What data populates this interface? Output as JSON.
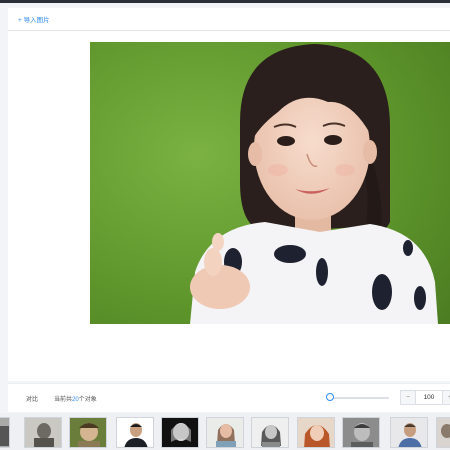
{
  "header": {
    "import_label": "+ 导入图片"
  },
  "toolbar": {
    "compare_label": "对比",
    "summary_prefix": "当前共",
    "object_count": "20",
    "summary_suffix": "个对象",
    "zoom_value": "100",
    "minus_label": "−",
    "plus_label": "+",
    "slider_level": 0
  },
  "colors": {
    "accent": "#2d8cf0",
    "grass": "#5f9a2b",
    "panel": "#ffffff"
  },
  "thumbnails": [
    "cropped-photo",
    "old-portrait",
    "green-portrait",
    "suit-portrait",
    "dark-portrait",
    "smiling-woman",
    "gray-woman",
    "red-hair-woman",
    "gray-man",
    "blue-shirt-man",
    "cropped-photo"
  ]
}
